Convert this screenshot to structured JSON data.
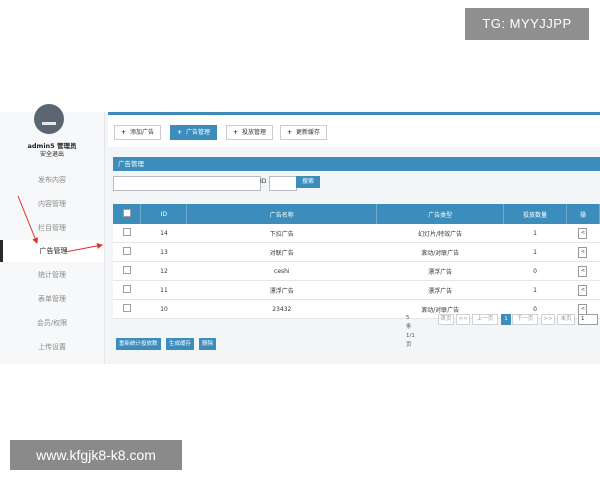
{
  "watermarks": {
    "top": "TG: MYYJJPP",
    "bottom": "www.kfgjk8-k8.com"
  },
  "sidebar": {
    "user_name": "admin5 管理员",
    "user_status": "安全退出",
    "items": [
      {
        "label": "发布内容"
      },
      {
        "label": "内容管理"
      },
      {
        "label": "栏目管理"
      },
      {
        "label": "广告管理"
      },
      {
        "label": "统计管理"
      },
      {
        "label": "表单管理"
      },
      {
        "label": "会员/权限"
      },
      {
        "label": "上传设置"
      }
    ]
  },
  "toolbar": {
    "add": "添加广告",
    "manage": "广告管理",
    "place": "投放管理",
    "cache": "更新缓存"
  },
  "panel": {
    "title": "广告管理"
  },
  "search": {
    "id_label": "ID",
    "button": "搜索",
    "keyword_value": "",
    "id_value": ""
  },
  "table": {
    "columns": [
      "",
      "ID",
      "广告名称",
      "广告类型",
      "投放数量",
      "操"
    ],
    "rows": [
      {
        "id": "14",
        "name": "下拉广告",
        "type": "幻灯片/特效广告",
        "count": "1",
        "action": "<"
      },
      {
        "id": "13",
        "name": "对联广告",
        "type": "滚动/对联广告",
        "count": "1",
        "action": "<"
      },
      {
        "id": "12",
        "name": "ceshi",
        "type": "漂浮广告",
        "count": "0",
        "action": "<"
      },
      {
        "id": "11",
        "name": "漂浮广告",
        "type": "漂浮广告",
        "count": "1",
        "action": "<"
      },
      {
        "id": "10",
        "name": "23432",
        "type": "滚动/对联广告",
        "count": "0",
        "action": "<"
      }
    ]
  },
  "pager": {
    "summary": "5条 1/1页",
    "first": "首页",
    "prev_arrow": "<<",
    "prev": "上一页",
    "current": "1",
    "next": "下一页",
    "next_arrow": ">>",
    "last": "末页",
    "input_value": "1"
  },
  "bottom_buttons": {
    "recount": "重新统计投放数",
    "generate": "生成缓存",
    "delete": "删除"
  },
  "colors": {
    "accent": "#3c8dbc",
    "arrow": "#e0302a"
  }
}
